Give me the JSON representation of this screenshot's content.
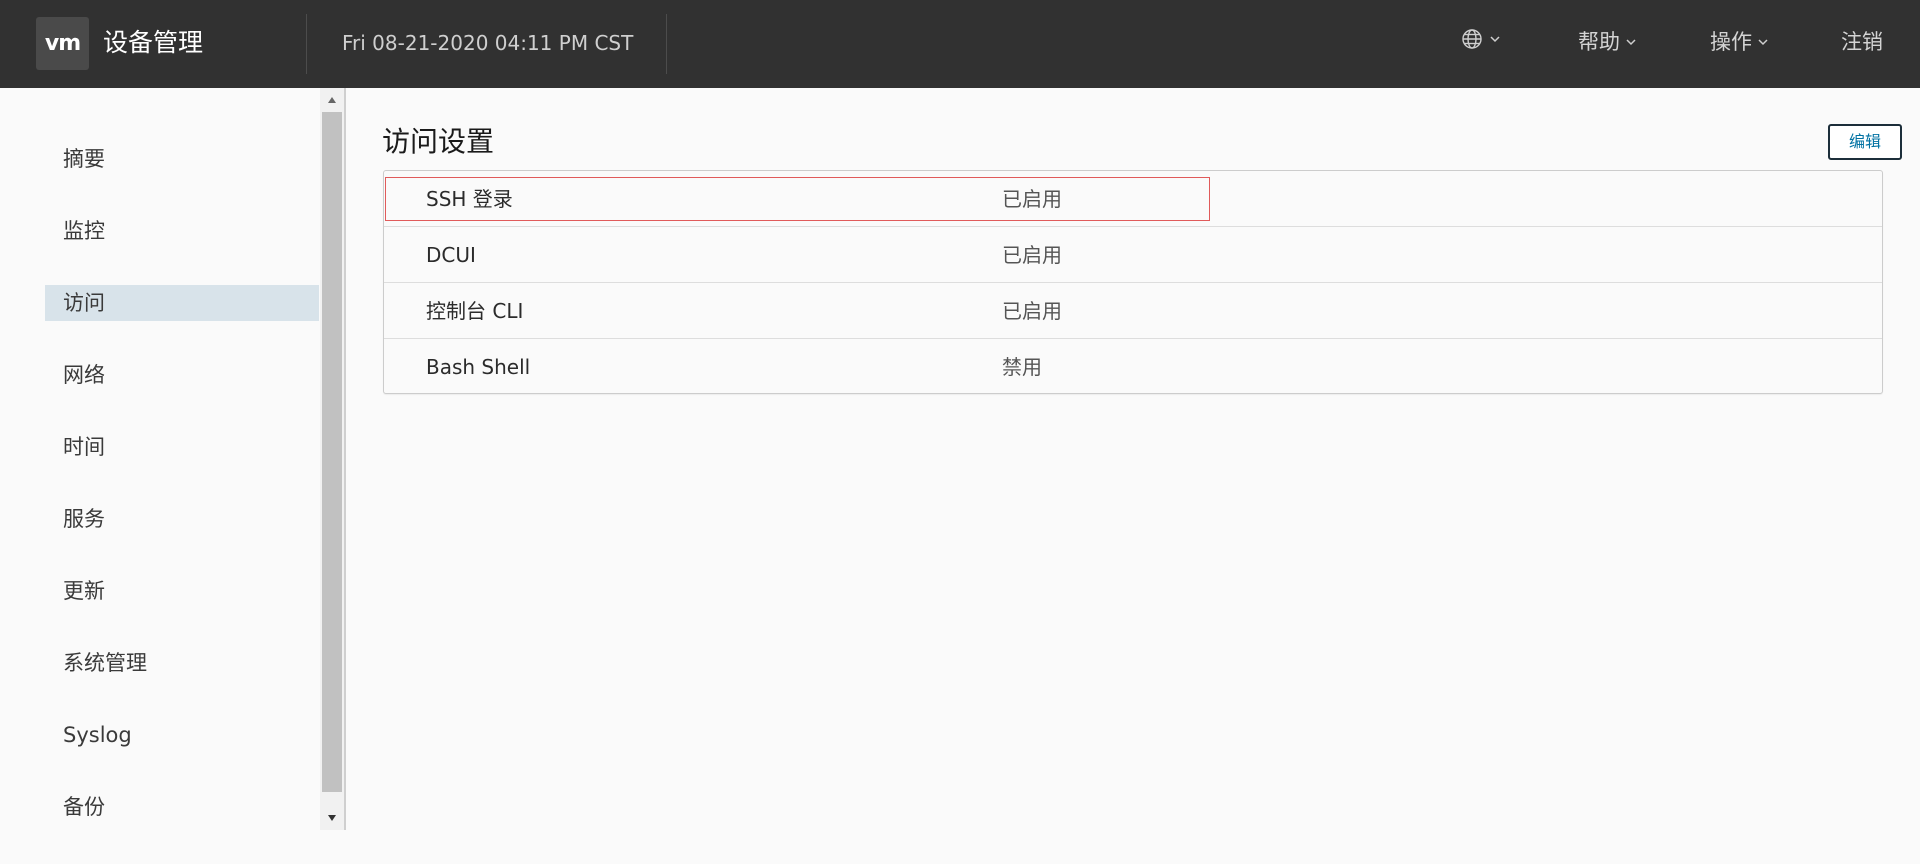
{
  "header": {
    "logo_text": "vm",
    "app_title": "设备管理",
    "datetime": "Fri 08-21-2020 04:11 PM CST",
    "language_icon": "globe-icon",
    "help_label": "帮助",
    "actions_label": "操作",
    "logout_label": "注销"
  },
  "sidebar": {
    "items": [
      {
        "label": "摘要",
        "active": false
      },
      {
        "label": "监控",
        "active": false
      },
      {
        "label": "访问",
        "active": true
      },
      {
        "label": "网络",
        "active": false
      },
      {
        "label": "时间",
        "active": false
      },
      {
        "label": "服务",
        "active": false
      },
      {
        "label": "更新",
        "active": false
      },
      {
        "label": "系统管理",
        "active": false
      },
      {
        "label": "Syslog",
        "active": false
      },
      {
        "label": "备份",
        "active": false
      }
    ]
  },
  "main": {
    "title": "访问设置",
    "edit_label": "编辑",
    "rows": [
      {
        "key": "SSH 登录",
        "value": "已启用"
      },
      {
        "key": "DCUI",
        "value": "已启用"
      },
      {
        "key": "控制台 CLI",
        "value": "已启用"
      },
      {
        "key": "Bash Shell",
        "value": "禁用"
      }
    ]
  },
  "colors": {
    "header_bg": "#313131",
    "active_nav_bg": "#d8e3ea",
    "link_blue": "#0072a3",
    "highlight_red": "#e05a5a"
  }
}
